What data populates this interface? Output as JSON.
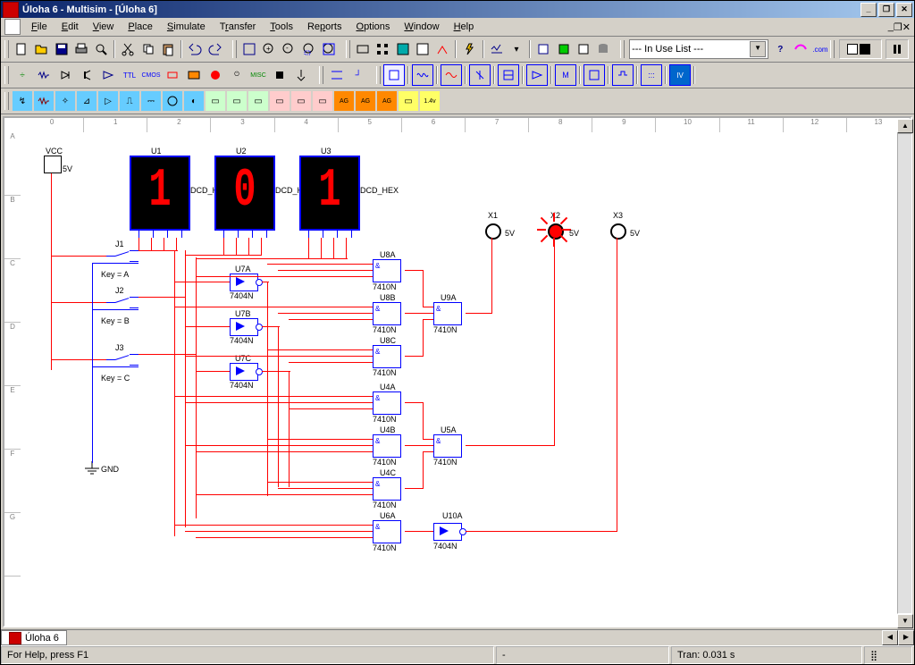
{
  "title": "Úloha 6 - Multisim - [Úloha 6]",
  "menus": [
    "File",
    "Edit",
    "View",
    "Place",
    "Simulate",
    "Transfer",
    "Tools",
    "Reports",
    "Options",
    "Window",
    "Help"
  ],
  "combo_inuse": "--- In Use List ---",
  "doc_tab": "Úloha 6",
  "status_help": "For Help, press F1",
  "status_tran": "Tran: 0.031 s",
  "ruler_h": [
    "0",
    "1",
    "2",
    "3",
    "4",
    "5",
    "6",
    "7",
    "8",
    "9",
    "10",
    "11",
    "12",
    "13"
  ],
  "ruler_v": [
    "A",
    "B",
    "C",
    "D",
    "E",
    "F",
    "G"
  ],
  "vcc": {
    "label": "VCC",
    "val": "5V"
  },
  "gnd": {
    "label": "GND"
  },
  "displays": [
    {
      "ref": "U1",
      "type": "DCD_HEX",
      "digit": "1"
    },
    {
      "ref": "U2",
      "type": "DCD_HEX",
      "digit": "0"
    },
    {
      "ref": "U3",
      "type": "DCD_HEX",
      "digit": "1"
    }
  ],
  "probes": [
    {
      "ref": "X1",
      "val": "5V",
      "on": false
    },
    {
      "ref": "X2",
      "val": "5V",
      "on": true
    },
    {
      "ref": "X3",
      "val": "5V",
      "on": false
    }
  ],
  "switches": [
    {
      "ref": "J1",
      "key": "Key = A"
    },
    {
      "ref": "J2",
      "key": "Key = B"
    },
    {
      "ref": "J3",
      "key": "Key = C"
    }
  ],
  "inverters": [
    {
      "ref": "U7A",
      "type": "7404N"
    },
    {
      "ref": "U7B",
      "type": "7404N"
    },
    {
      "ref": "U7C",
      "type": "7404N"
    },
    {
      "ref": "U10A",
      "type": "7404N"
    }
  ],
  "nands": [
    {
      "ref": "U8A",
      "type": "7410N"
    },
    {
      "ref": "U8B",
      "type": "7410N"
    },
    {
      "ref": "U8C",
      "type": "7410N"
    },
    {
      "ref": "U9A",
      "type": "7410N"
    },
    {
      "ref": "U4A",
      "type": "7410N"
    },
    {
      "ref": "U4B",
      "type": "7410N"
    },
    {
      "ref": "U4C",
      "type": "7410N"
    },
    {
      "ref": "U5A",
      "type": "7410N"
    },
    {
      "ref": "U6A",
      "type": "7410N"
    }
  ]
}
